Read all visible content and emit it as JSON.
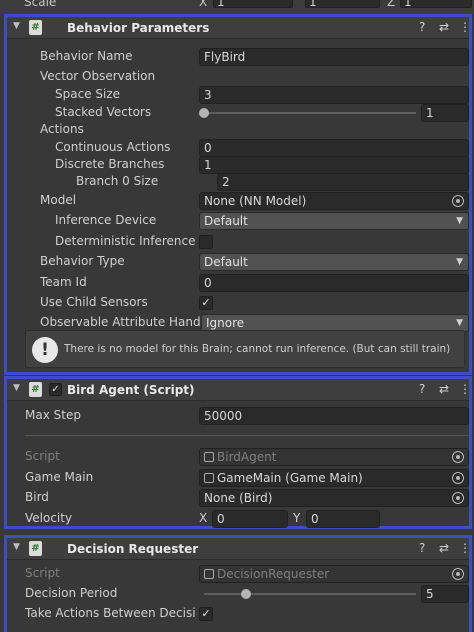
{
  "scale_row": {
    "label": "Scale",
    "x": "X",
    "x_value": "1",
    "y_value": "1",
    "z": "Z",
    "z_value": "1"
  },
  "behavior_parameters": {
    "title": "Behavior Parameters",
    "behavior_name": {
      "label": "Behavior Name",
      "value": "FlyBird"
    },
    "vector_observation_label": "Vector Observation",
    "space_size": {
      "label": "Space Size",
      "value": "3"
    },
    "stacked_vectors": {
      "label": "Stacked Vectors",
      "value": "1",
      "slider_fraction": 0.0
    },
    "actions_label": "Actions",
    "continuous_actions": {
      "label": "Continuous Actions",
      "value": "0"
    },
    "discrete_branches": {
      "label": "Discrete Branches",
      "value": "1"
    },
    "branch_0_size": {
      "label": "Branch 0 Size",
      "value": "2"
    },
    "model": {
      "label": "Model",
      "value": "None (NN Model)"
    },
    "inference_device": {
      "label": "Inference Device",
      "value": "Default"
    },
    "deterministic_inference": {
      "label": "Deterministic Inference",
      "checked": false
    },
    "behavior_type": {
      "label": "Behavior Type",
      "value": "Default"
    },
    "team_id": {
      "label": "Team Id",
      "value": "0"
    },
    "use_child_sensors": {
      "label": "Use Child Sensors",
      "checked": true,
      "mark": "✓"
    },
    "observable_attribute": {
      "label": "Observable Attribute Handl",
      "value": "Ignore"
    },
    "help_message": "There is no model for this Brain; cannot run inference. (But can still train)"
  },
  "bird_agent": {
    "title": "Bird Agent (Script)",
    "enabled_mark": "✓",
    "max_step": {
      "label": "Max Step",
      "value": "50000"
    },
    "script": {
      "label": "Script",
      "value": "BirdAgent"
    },
    "game_main": {
      "label": "Game Main",
      "value": "GameMain (Game Main)"
    },
    "bird": {
      "label": "Bird",
      "value": "None (Bird)"
    },
    "velocity": {
      "label": "Velocity",
      "x_label": "X",
      "x_value": "0",
      "y_label": "Y",
      "y_value": "0"
    }
  },
  "decision_requester": {
    "title": "Decision Requester",
    "script": {
      "label": "Script",
      "value": "DecisionRequester"
    },
    "decision_period": {
      "label": "Decision Period",
      "value": "5",
      "slider_fraction": 0.2
    },
    "take_actions": {
      "label": "Take Actions Between Decisi",
      "checked": true,
      "mark": "✓"
    }
  },
  "header_icons": {
    "help": "?",
    "settings": "⇄",
    "menu": "⋮",
    "fold": "▼",
    "script_glyph": "#",
    "alert": "!",
    "dropdown_arrow": "▼"
  },
  "colors": {
    "highlight_border": "#3b4ec4",
    "panel_bg": "#383838",
    "field_bg": "#2a2a2a"
  }
}
